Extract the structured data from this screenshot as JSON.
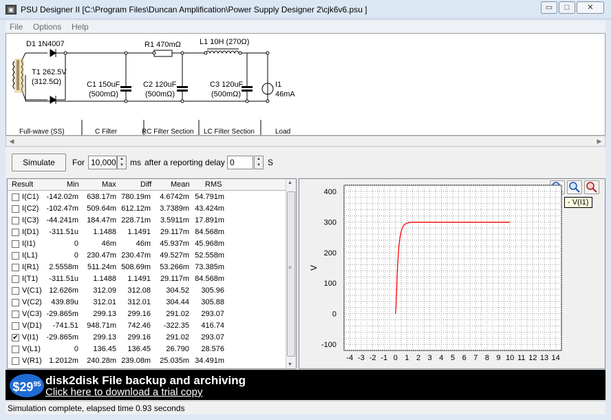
{
  "window": {
    "title": "PSU Designer II  [C:\\Program Files\\Duncan Amplification\\Power Supply Designer 2\\cjk6v6.psu ]",
    "controls": {
      "minimize": "▭",
      "maximize": "□",
      "close": "✕"
    }
  },
  "menu": [
    "File",
    "Options",
    "Help"
  ],
  "schematic": {
    "d1": "D1 1N4007",
    "t1_line1": "T1 262.5V",
    "t1_line2": "(312.5Ω)",
    "r1": "R1 470mΩ",
    "l1": "L1 10H (270Ω)",
    "c1_line1": "C1 150uF",
    "c1_line2": "(500mΩ)",
    "c2_line1": "C2 120uF",
    "c2_line2": "(500mΩ)",
    "c3_line1": "C3 120uF",
    "c3_line2": "(500mΩ)",
    "i1_line1": "I1",
    "i1_line2": "46mA",
    "sections": [
      "Full-wave (SS)",
      "C Filter",
      "RC Filter Section",
      "LC Filter Section",
      "Load"
    ]
  },
  "toolbar": {
    "simulate_label": "Simulate",
    "for_label": "For",
    "duration_value": "10,000",
    "ms_label": "ms",
    "delay_label": "after a reporting delay of",
    "delay_value": "0",
    "s_label": "S"
  },
  "results": {
    "columns": [
      "Result",
      "Min",
      "Max",
      "Diff",
      "Mean",
      "RMS"
    ],
    "rows": [
      {
        "name": "I(C1)",
        "checked": false,
        "min": "-142.02m",
        "max": "638.17m",
        "diff": "780.19m",
        "mean": "4.6742m",
        "rms": "54.791m"
      },
      {
        "name": "I(C2)",
        "checked": false,
        "min": "-102.47m",
        "max": "509.64m",
        "diff": "612.12m",
        "mean": "3.7389m",
        "rms": "43.424m"
      },
      {
        "name": "I(C3)",
        "checked": false,
        "min": "-44.241m",
        "max": "184.47m",
        "diff": "228.71m",
        "mean": "3.5911m",
        "rms": "17.891m"
      },
      {
        "name": "I(D1)",
        "checked": false,
        "min": "-311.51u",
        "max": "1.1488",
        "diff": "1.1491",
        "mean": "29.117m",
        "rms": "84.568m"
      },
      {
        "name": "I(I1)",
        "checked": false,
        "min": "0",
        "max": "46m",
        "diff": "46m",
        "mean": "45.937m",
        "rms": "45.968m"
      },
      {
        "name": "I(L1)",
        "checked": false,
        "min": "0",
        "max": "230.47m",
        "diff": "230.47m",
        "mean": "49.527m",
        "rms": "52.558m"
      },
      {
        "name": "I(R1)",
        "checked": false,
        "min": "2.5558m",
        "max": "511.24m",
        "diff": "508.69m",
        "mean": "53.266m",
        "rms": "73.385m"
      },
      {
        "name": "I(T1)",
        "checked": false,
        "min": "-311.51u",
        "max": "1.1488",
        "diff": "1.1491",
        "mean": "29.117m",
        "rms": "84.568m"
      },
      {
        "name": "V(C1)",
        "checked": false,
        "min": "12.626m",
        "max": "312.09",
        "diff": "312.08",
        "mean": "304.52",
        "rms": "305.96"
      },
      {
        "name": "V(C2)",
        "checked": false,
        "min": "439.89u",
        "max": "312.01",
        "diff": "312.01",
        "mean": "304.44",
        "rms": "305.88"
      },
      {
        "name": "V(C3)",
        "checked": false,
        "min": "-29.865m",
        "max": "299.13",
        "diff": "299.16",
        "mean": "291.02",
        "rms": "293.07"
      },
      {
        "name": "V(D1)",
        "checked": false,
        "min": "-741.51",
        "max": "948.71m",
        "diff": "742.46",
        "mean": "-322.35",
        "rms": "416.74"
      },
      {
        "name": "V(I1)",
        "checked": true,
        "min": "-29.865m",
        "max": "299.13",
        "diff": "299.16",
        "mean": "291.02",
        "rms": "293.07"
      },
      {
        "name": "V(L1)",
        "checked": false,
        "min": "0",
        "max": "136.45",
        "diff": "136.45",
        "mean": "26.790",
        "rms": "28.576"
      },
      {
        "name": "V(R1)",
        "checked": false,
        "min": "1.2012m",
        "max": "240.28m",
        "diff": "239.08m",
        "mean": "25.035m",
        "rms": "34.491m"
      }
    ]
  },
  "plot": {
    "tooltip": "- V(I1)",
    "zoom_icons": [
      "zoom-in-icon",
      "zoom-fit-icon",
      "zoom-out-icon"
    ]
  },
  "chart_data": {
    "type": "line",
    "ylabel": "V",
    "xlim": [
      -4.5,
      14.5
    ],
    "ylim": [
      -120,
      420
    ],
    "x_ticks": [
      -4,
      -3,
      -2,
      -1,
      0,
      1,
      2,
      3,
      4,
      5,
      6,
      7,
      8,
      9,
      10,
      11,
      12,
      13,
      14
    ],
    "y_ticks": [
      -100,
      0,
      100,
      200,
      300,
      400
    ],
    "grid": true,
    "line_color": "#ff0000",
    "series": [
      {
        "name": "V(I1)",
        "x": [
          0,
          0.05,
          0.1,
          0.15,
          0.2,
          0.25,
          0.3,
          0.4,
          0.5,
          0.6,
          0.7,
          0.8,
          1.0,
          1.2,
          1.5,
          2.0,
          3.0,
          5.0,
          7.0,
          10.0
        ],
        "y": [
          0,
          30,
          80,
          130,
          170,
          200,
          222,
          252,
          270,
          281,
          288,
          292,
          296,
          298,
          299,
          299,
          299,
          299,
          299,
          299
        ]
      }
    ]
  },
  "banner": {
    "price_main": "$29",
    "price_cents": "95",
    "title": "disk2disk File backup and archiving",
    "link": "Click here to download a trial copy"
  },
  "status": "Simulation complete, elapsed time 0.93 seconds"
}
